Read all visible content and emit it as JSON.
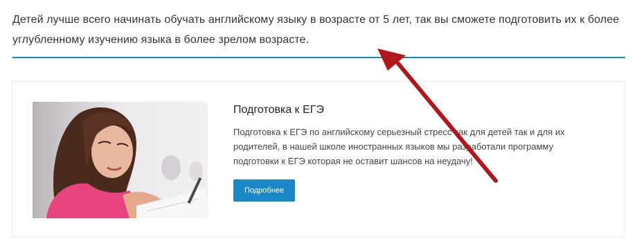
{
  "intro": {
    "text": "Детей лучше всего начинать обучать английскому языку в возрасте от 5 лет, так вы сможете подготовить их к более углубленному изучению языка в более зрелом возрасте."
  },
  "card": {
    "title": "Подготовка к ЕГЭ",
    "description": "Подготовка к ЕГЭ по английскому серьезный стресс как для детей так и для их родителей, в нашей школе иностранных языков мы разработали программу подготовки к ЕГЭ которая не оставит шансов на неудачу!",
    "button_label": "Подробнее",
    "image_icon": "student-photo"
  },
  "colors": {
    "accent": "#1a87c9",
    "divider": "#1a87b9",
    "annotation_arrow": "#b1161c"
  }
}
